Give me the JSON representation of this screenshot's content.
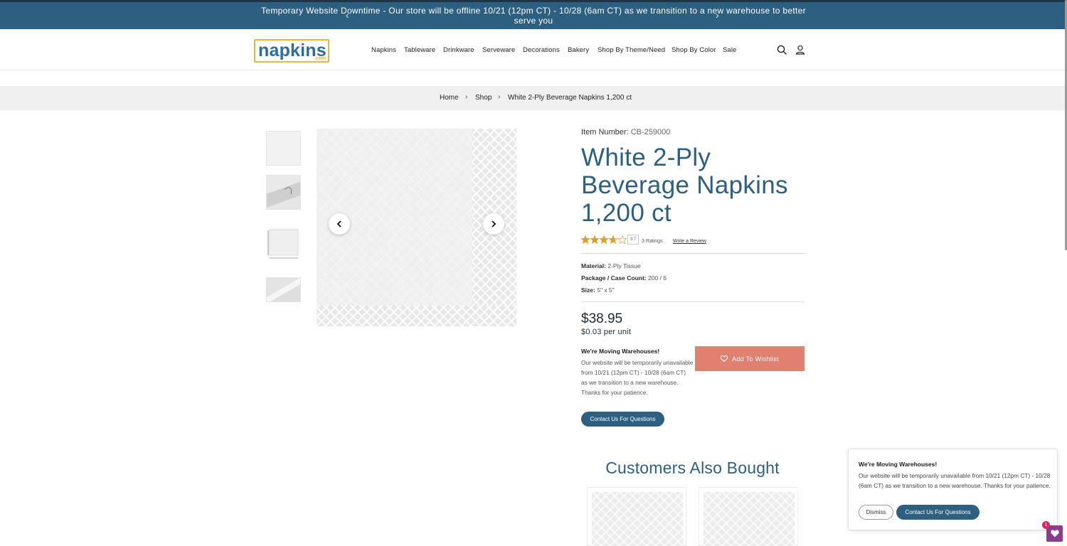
{
  "announcement": {
    "text": "Temporary Website Downtime - Our store will be offline 10/21 (12pm CT) - 10/28 (6am CT) as we transition to a new warehouse to better serve you",
    "prev_icon": "chevron-left-icon",
    "next_icon": "chevron-right-icon"
  },
  "header": {
    "logo_word": "napkins",
    "logo_suffix": ".com",
    "nav": [
      "Napkins",
      "Tableware",
      "Drinkware",
      "Serveware",
      "Decorations",
      "Bakery",
      "Shop By Theme/Need",
      "Shop By Color",
      "Sale"
    ],
    "icons": [
      "search-icon",
      "account-icon"
    ]
  },
  "breadcrumb": {
    "items": [
      "Home",
      "Shop",
      "White 2-Ply Beverage Napkins 1,200 ct"
    ],
    "separator": "›"
  },
  "gallery": {
    "thumbnail_count": 4,
    "prev_icon": "chevron-left-icon",
    "next_icon": "chevron-right-icon"
  },
  "product": {
    "item_number_label": "Item Number:",
    "item_number": "CB-259000",
    "title": "White 2-Ply Beverage Napkins 1,200 ct",
    "rating": "3.7",
    "rating_value": 3.7,
    "ratings_count": "3 Ratings",
    "write_review": "Write a Review",
    "specs": [
      {
        "label": "Material:",
        "value": "2-Ply Tissue"
      },
      {
        "label": "Package / Case Count:",
        "value": "200 / 6"
      },
      {
        "label": "Size:",
        "value": "5\" x 5\""
      }
    ],
    "price": "$38.95",
    "unit_price": "$0.03 per unit",
    "notice_heading": "We're Moving Warehouses!",
    "notice_body": "Our website will be temporarily unavailable from 10/21 (12pm CT) - 10/28 (6am CT) as we transition to a new warehouse. Thanks for your patience.",
    "contact_label": "Contact Us For Questions",
    "wishlist_label": "Add To Wishlist"
  },
  "also_bought": {
    "heading": "Customers Also Bought"
  },
  "popup": {
    "heading": "We're Moving Warehouses!",
    "body": "Our website will be temporarily unavailable from 10/21 (12pm CT) - 10/28 (6am CT) as we transition to a new warehouse. Thanks for your patience.",
    "dismiss_label": "Dismiss",
    "contact_label": "Contact Us For Questions"
  },
  "wishlist_fab": {
    "count": "1",
    "icon": "heart-icon"
  },
  "colors": {
    "brand_blue": "#2d5f80",
    "announcement_bg": "#2d5f80",
    "wishlist_button": "#df8070",
    "star": "#d8a12f",
    "logo_border": "#f2b233",
    "fab": "#8a3d8f"
  }
}
